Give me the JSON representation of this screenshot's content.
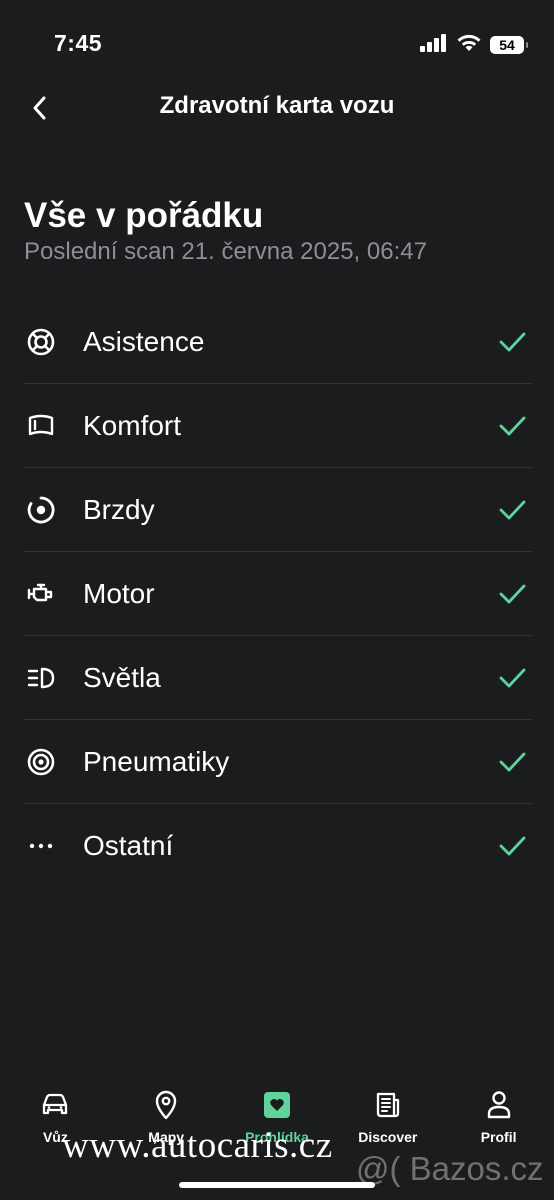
{
  "status": {
    "time": "7:45",
    "battery": "54"
  },
  "nav": {
    "title": "Zdravotní karta vozu"
  },
  "hero": {
    "title": "Vše v pořádku",
    "subtitle": "Poslední scan 21. června 2025, 06:47"
  },
  "items": [
    {
      "label": "Asistence",
      "icon": "lifebuoy-icon"
    },
    {
      "label": "Komfort",
      "icon": "seat-icon"
    },
    {
      "label": "Brzdy",
      "icon": "brake-disc-icon"
    },
    {
      "label": "Motor",
      "icon": "engine-icon"
    },
    {
      "label": "Světla",
      "icon": "headlight-icon"
    },
    {
      "label": "Pneumatiky",
      "icon": "tire-icon"
    },
    {
      "label": "Ostatní",
      "icon": "more-dots-icon"
    }
  ],
  "tabs": [
    {
      "label": "Vůz",
      "icon": "car-icon"
    },
    {
      "label": "Mapy",
      "icon": "map-pin-icon"
    },
    {
      "label": "Prohlídka",
      "icon": "heart-checkup-icon"
    },
    {
      "label": "Discover",
      "icon": "news-icon"
    },
    {
      "label": "Profil",
      "icon": "person-icon"
    }
  ],
  "colors": {
    "background": "#1b1c1e",
    "accent": "#5fd39a",
    "muted": "#8e8f93",
    "divider": "#34363a"
  },
  "watermark": {
    "left": "www.autocaris.cz",
    "right": "@( Bazos.cz"
  }
}
